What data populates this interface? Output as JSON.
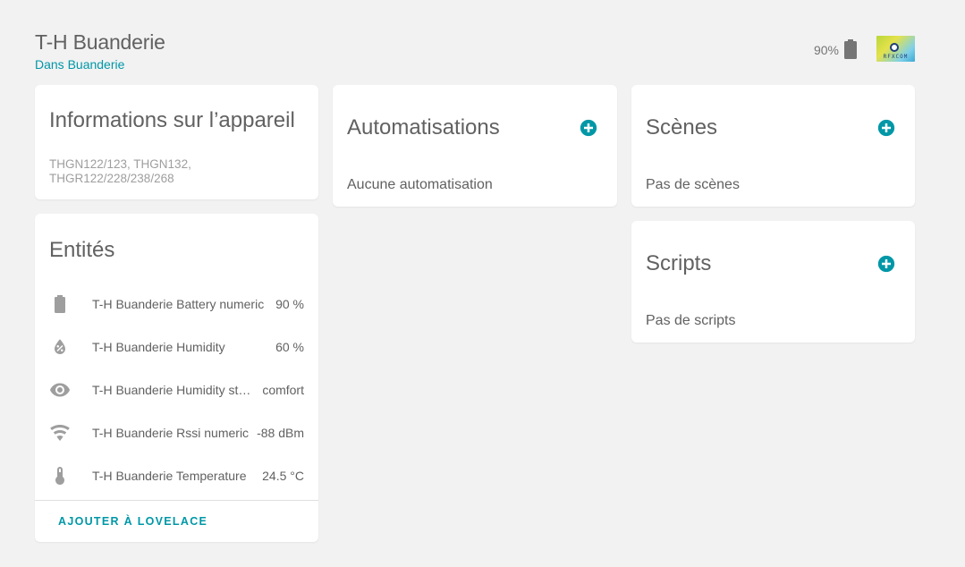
{
  "header": {
    "title": "T-H Buanderie",
    "area": "Dans Buanderie",
    "battery": "90%",
    "logo_text": "RFXCOM"
  },
  "device_info": {
    "title": "Informations sur l’appareil",
    "model_line1": "THGN122/123, THGN132,",
    "model_line2": "THGR122/228/238/268"
  },
  "entities": {
    "title": "Entités",
    "items": [
      {
        "name": "T-H Buanderie Battery numeric",
        "state": "90 %",
        "icon": "battery-icon"
      },
      {
        "name": "T-H Buanderie Humidity",
        "state": "60 %",
        "icon": "water-percent-icon"
      },
      {
        "name": "T-H Buanderie Humidity status",
        "state": "comfort",
        "icon": "eye-icon"
      },
      {
        "name": "T-H Buanderie Rssi numeric",
        "state": "-88 dBm",
        "icon": "wifi-icon"
      },
      {
        "name": "T-H Buanderie Temperature",
        "state": "24.5 °C",
        "icon": "thermometer-icon"
      }
    ],
    "add_lovelace": "AJOUTER À LOVELACE"
  },
  "automations": {
    "title": "Automatisations",
    "empty": "Aucune automatisation"
  },
  "scenes": {
    "title": "Scènes",
    "empty": "Pas de scènes"
  },
  "scripts": {
    "title": "Scripts",
    "empty": "Pas de scripts"
  },
  "colors": {
    "accent": "#0097a7",
    "icon": "#9e9e9e",
    "background": "#f2f2f2"
  }
}
